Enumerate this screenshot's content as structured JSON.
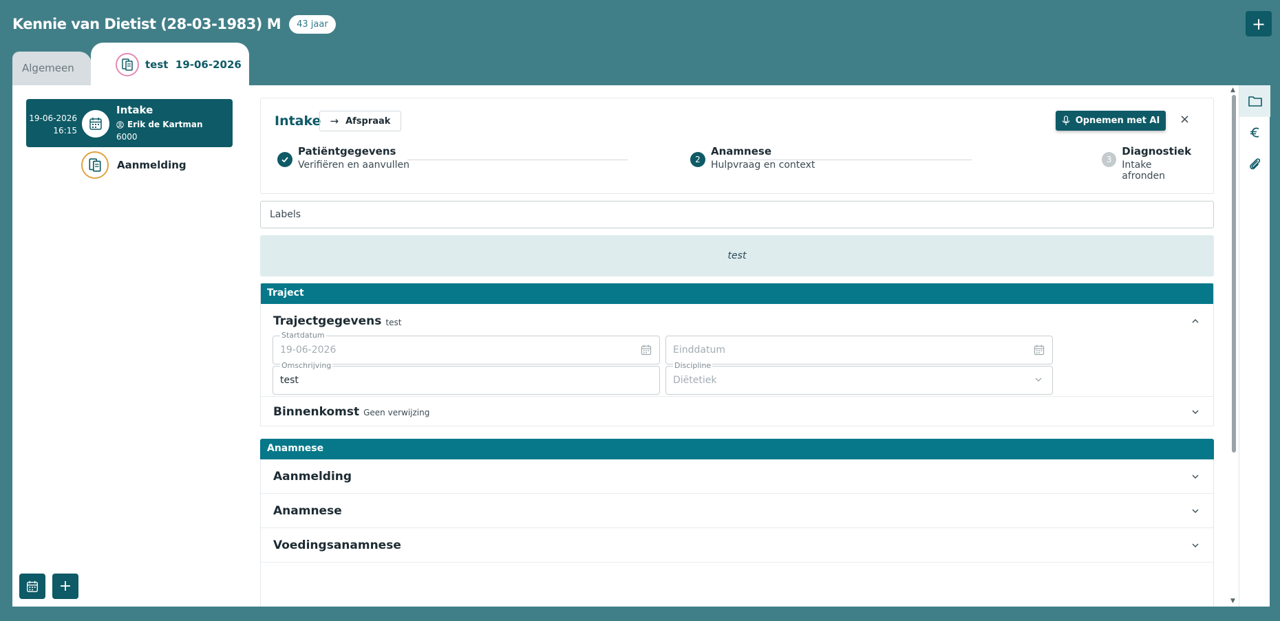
{
  "header": {
    "patient_name": "Kennie van Dietist (28-03-1983) M",
    "age_badge": "43 jaar",
    "add_symbol": "+"
  },
  "tabs": {
    "general": "Algemeen",
    "active": "test  19-06-2026"
  },
  "sidebar": {
    "intake_card": {
      "date": "19-06-2026",
      "time": "16:15",
      "title": "Intake",
      "user": "Erik de Kartman",
      "code": "6000"
    },
    "aanmelding": "Aanmelding",
    "bottom_add": "+"
  },
  "step_card": {
    "title": "Intake",
    "afspraak_label": "Afspraak",
    "ai_button_label": "Opnemen met AI",
    "close_symbol": "×",
    "steps": [
      {
        "title": "Patiëntgegevens",
        "sub": "Verifiëren en aanvullen",
        "status": "done"
      },
      {
        "number": "2",
        "title": "Anamnese",
        "sub": "Hulpvraag en context",
        "status": "active"
      },
      {
        "number": "3",
        "title": "Diagnostiek",
        "sub": "Intake afronden",
        "status": "pending"
      }
    ]
  },
  "labels_placeholder": "Labels",
  "note_text": "test",
  "traject": {
    "header": "Traject",
    "gegevens_title": "Trajectgegevens",
    "gegevens_sub": "test",
    "startdatum_label": "Startdatum",
    "startdatum_value": "19-06-2026",
    "einddatum_placeholder": "Einddatum",
    "omschrijving_label": "Omschrijving",
    "omschrijving_value": "test",
    "discipline_label": "Discipline",
    "discipline_value": "Diëtetiek",
    "binnenkomst_title": "Binnenkomst",
    "binnenkomst_sub": "Geen verwijzing"
  },
  "anamnese": {
    "header": "Anamnese",
    "rows": [
      "Aanmelding",
      "Anamnese",
      "Voedingsanamnese"
    ]
  },
  "colors": {
    "background": "#417f88",
    "primary": "#0e5a66",
    "section_header": "#06788a",
    "step_done": "#0e5a66",
    "step_pending": "#c4cbce",
    "note_bg": "#dfecee"
  },
  "icons": {
    "calendar": "calendar-icon",
    "document": "document-icon",
    "user": "user-icon",
    "microphone": "microphone-icon",
    "folder": "folder-icon",
    "euro": "euro-icon",
    "paperclip": "paperclip-icon"
  }
}
